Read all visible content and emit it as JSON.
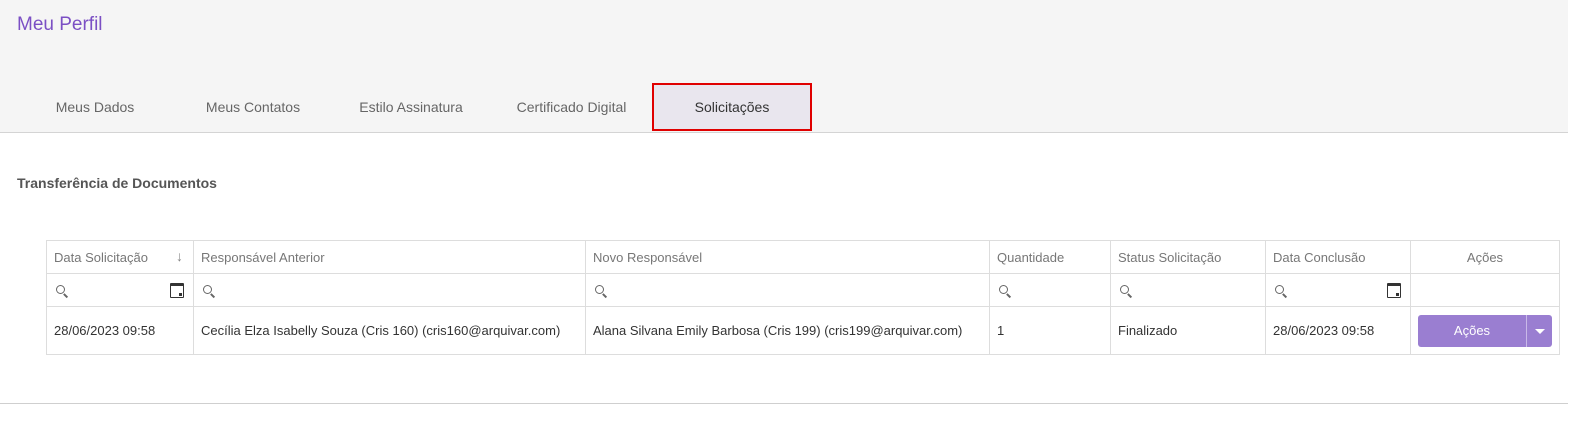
{
  "page": {
    "title": "Meu Perfil"
  },
  "tabs": [
    {
      "label": "Meus Dados"
    },
    {
      "label": "Meus Contatos"
    },
    {
      "label": "Estilo Assinatura"
    },
    {
      "label": "Certificado Digital"
    },
    {
      "label": "Solicitações",
      "active": true
    }
  ],
  "section": {
    "title": "Transferência de Documentos"
  },
  "table": {
    "columns": [
      "Data Solicitação",
      "Responsável Anterior",
      "Novo Responsável",
      "Quantidade",
      "Status Solicitação",
      "Data Conclusão",
      "Ações"
    ],
    "rows": [
      {
        "data_solicitacao": "28/06/2023 09:58",
        "responsavel_anterior": "Cecília Elza Isabelly Souza (Cris 160) (cris160@arquivar.com)",
        "novo_responsavel": "Alana Silvana Emily Barbosa (Cris 199) (cris199@arquivar.com)",
        "quantidade": "1",
        "status": "Finalizado",
        "data_conclusao": "28/06/2023 09:58",
        "acoes_label": "Ações"
      }
    ]
  },
  "icons": {
    "sort": "sort-down-arrow-icon",
    "search": "search-icon",
    "calendar": "calendar-icon",
    "dropdown": "caret-down-icon"
  },
  "colors": {
    "accent": "#7b4fc4",
    "button": "#9a7ed1",
    "highlight_border": "#e00000"
  }
}
